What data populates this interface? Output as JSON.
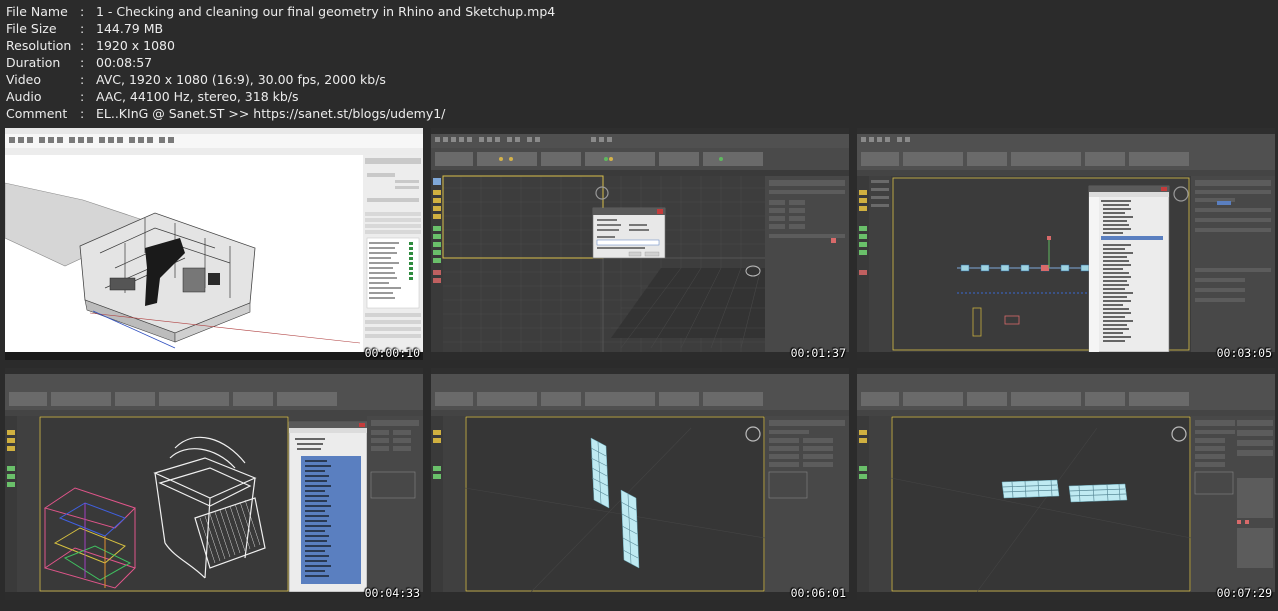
{
  "file_info": [
    {
      "key": "File Name",
      "value": "1 - Checking and cleaning our final geometry in Rhino and Sketchup.mp4"
    },
    {
      "key": "File Size",
      "value": "144.79 MB"
    },
    {
      "key": "Resolution",
      "value": "1920 x 1080"
    },
    {
      "key": "Duration",
      "value": "00:08:57"
    },
    {
      "key": "Video",
      "value": "AVC, 1920 x 1080 (16:9), 30.00 fps, 2000 kb/s"
    },
    {
      "key": "Audio",
      "value": "AAC, 44100 Hz, stereo, 318 kb/s"
    },
    {
      "key": "Comment",
      "value": "EL..KInG @ Sanet.ST >> https://sanet.st/blogs/udemy1/"
    }
  ],
  "separator": ":",
  "thumbnails": [
    {
      "timestamp": "00:00:10",
      "scene": "sketchup-floorplan"
    },
    {
      "timestamp": "00:01:37",
      "scene": "3dsmax-import-dialog"
    },
    {
      "timestamp": "00:03:05",
      "scene": "3dsmax-scene-explorer"
    },
    {
      "timestamp": "00:04:33",
      "scene": "3dsmax-chair-wireframe"
    },
    {
      "timestamp": "00:06:01",
      "scene": "3dsmax-panels"
    },
    {
      "timestamp": "00:07:29",
      "scene": "3dsmax-benches"
    }
  ],
  "colors": {
    "background": "#2b2b2b",
    "max_ui": "#444444",
    "viewport": "#3d3d3d",
    "sketchup_bg": "#f2f2f2",
    "selection": "#5a7fc0",
    "mesh_cyan": "#bfeaf2"
  }
}
